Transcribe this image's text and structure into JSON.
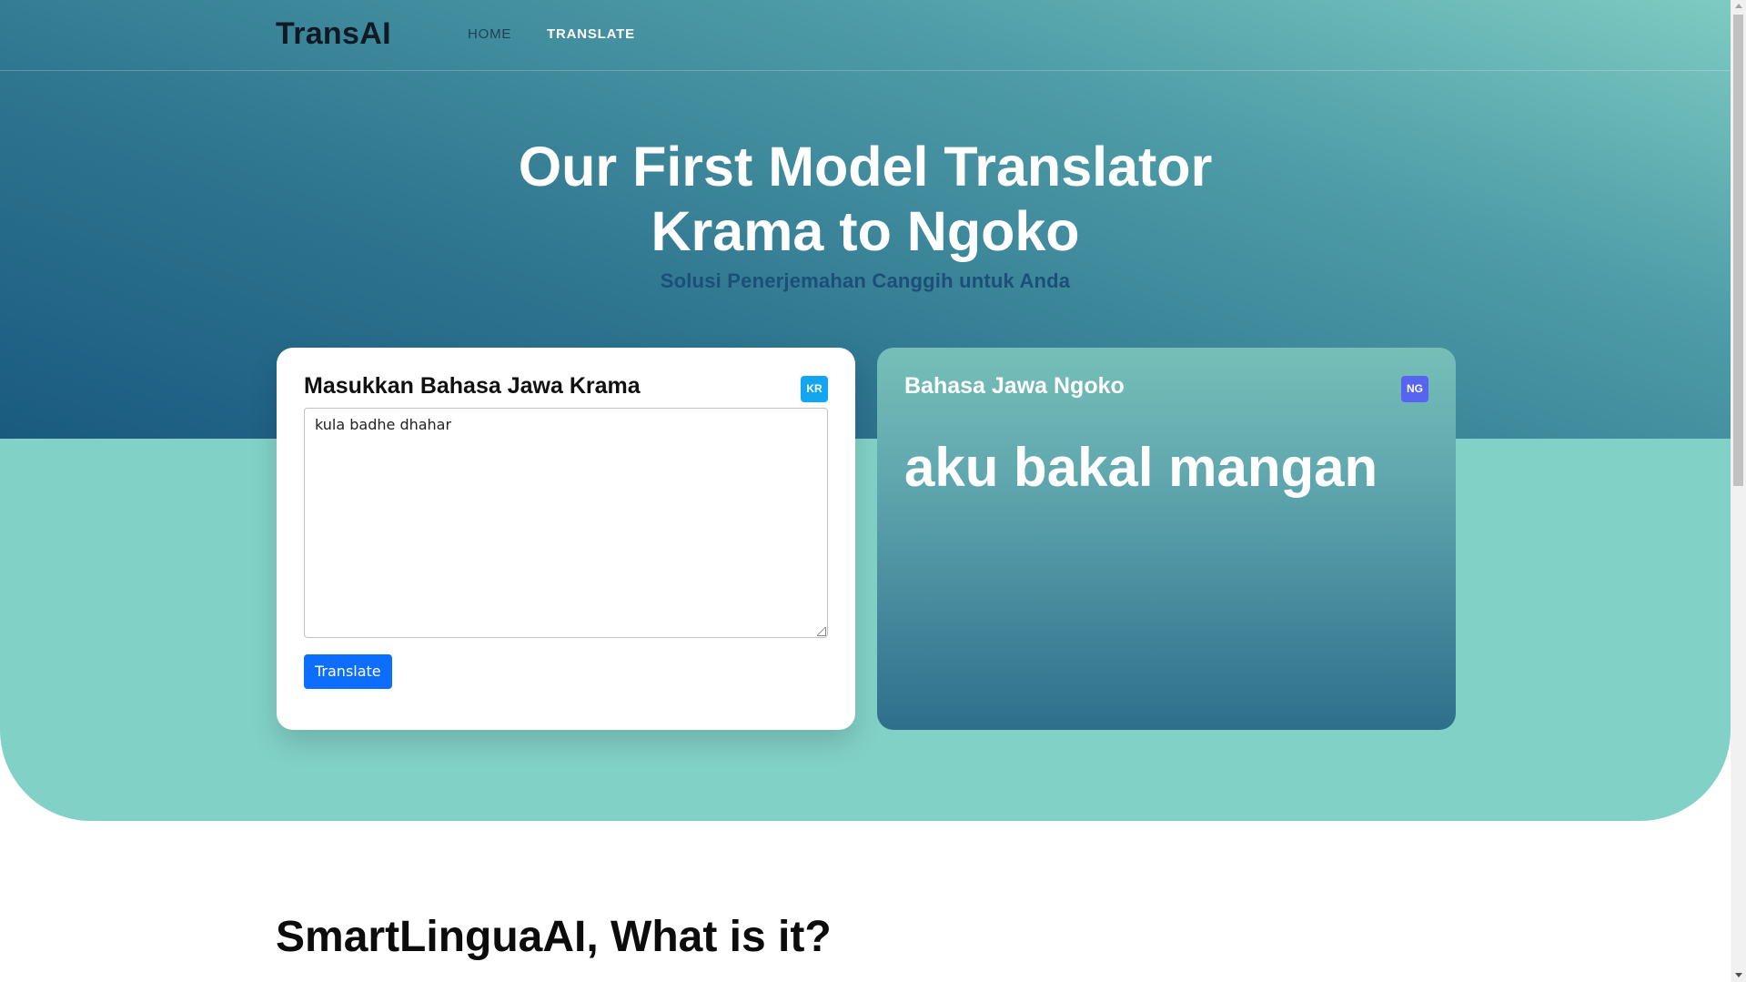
{
  "nav": {
    "brand": "TransAI",
    "links": [
      {
        "label": "HOME"
      },
      {
        "label": "TRANSLATE"
      }
    ]
  },
  "hero": {
    "title_line1": "Our First Model Translator",
    "title_line2": "Krama to Ngoko",
    "subtitle": "Solusi Penerjemahan Canggih untuk Anda"
  },
  "input_card": {
    "title": "Masukkan Bahasa Jawa Krama",
    "badge": "KR",
    "input_value": "kula badhe dhahar",
    "button_label": "Translate"
  },
  "output_card": {
    "title": "Bahasa Jawa Ngoko",
    "badge": "NG",
    "output_text": "aku bakal mangan"
  },
  "about": {
    "title": "SmartLinguaAI, What is it?"
  },
  "colors": {
    "hero_teal": "#82d1c7",
    "hero_dark": "#1a5a80",
    "button": "#0d6efd",
    "badge_kr": "#12a6f0",
    "badge_ng": "#5764f2"
  }
}
